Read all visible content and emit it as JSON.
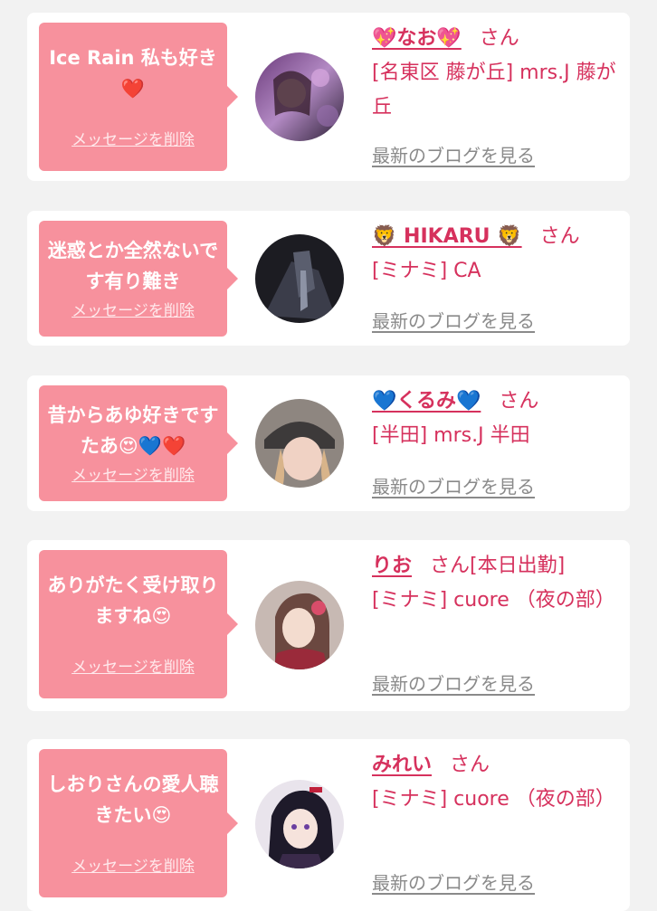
{
  "colors": {
    "bubble": "#f7919d",
    "accent": "#d6315d",
    "link_gray": "#8a8a8a",
    "background": "#f2f2f2"
  },
  "delete_label": "メッセージを削除",
  "blog_label": "最新のブログを見る",
  "items": [
    {
      "message": "Ice Rain 私も好き❤️",
      "name": "💖なお💖",
      "honorific": "さん",
      "area": "[名東区 藤が丘] mrs.J 藤が丘"
    },
    {
      "message": "迷惑とか全然ないです有り難き",
      "name": "🦁 HIKARU 🦁",
      "honorific": "さん",
      "area": "[ミナミ] CA"
    },
    {
      "message": "昔からあゆ好きですたあ😍💙❤️",
      "name": "💙くるみ💙",
      "honorific": "さん",
      "area": "[半田] mrs.J 半田"
    },
    {
      "message": "ありがたく受け取りますね😍",
      "name": "りお",
      "honorific": "さん[本日出勤]",
      "area": "[ミナミ] cuore （夜の部）"
    },
    {
      "message": "しおりさんの愛人聴きたい😍",
      "name": "みれい",
      "honorific": "さん",
      "area": "[ミナミ] cuore （夜の部）"
    }
  ]
}
